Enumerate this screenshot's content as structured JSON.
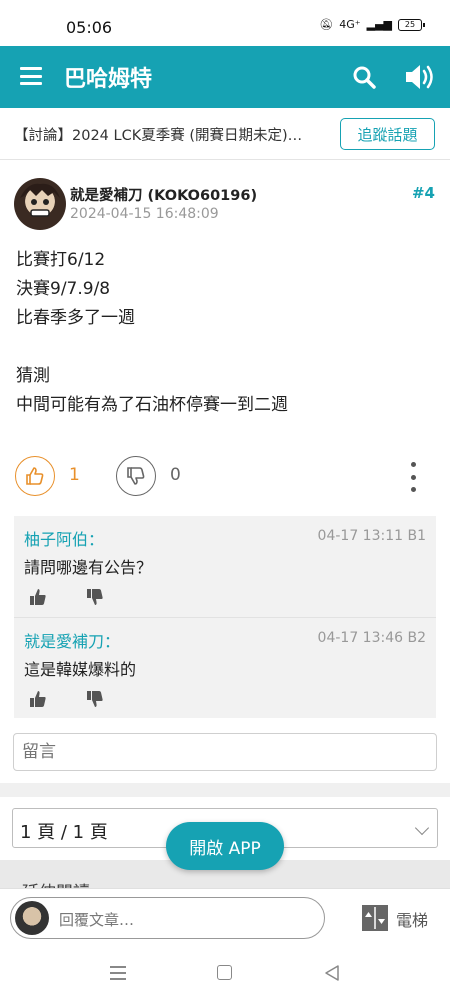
{
  "status_bar": {
    "time": "05:06",
    "network": "4G⁺",
    "battery": "25"
  },
  "header": {
    "title": "巴哈姆特",
    "accent_color": "#16a2b3"
  },
  "topic": {
    "title": "【討論】2024 LCK夏季賽 (開賽日期未定)…",
    "follow_label": "追蹤話題"
  },
  "post": {
    "author": "就是愛補刀 (KOKO60196)",
    "time": "2024-04-15 16:48:09",
    "floor": "#4",
    "lines": [
      "比賽打6/12",
      "決賽9/7.9/8",
      "比春季多了一週",
      "",
      "猜測",
      "中間可能有為了石油杯停賽一到二週"
    ],
    "gp_count": "1",
    "bp_count": "0"
  },
  "comments": [
    {
      "name": "柚子阿伯：",
      "meta": "04-17 13:11  B1",
      "text": "請問哪邊有公告？"
    },
    {
      "name": "就是愛補刀：",
      "meta": "04-17 13:46  B2",
      "text": "這是韓媒爆料的"
    }
  ],
  "reply": {
    "placeholder": "留言"
  },
  "pagination": {
    "label": "1 頁 / 1 頁"
  },
  "open_app": {
    "label": "開啟 APP"
  },
  "hot_section": {
    "label": "延伸閱讀"
  },
  "bottom_bar": {
    "reply_placeholder": "回覆文章…",
    "elevator_label": "電梯"
  }
}
